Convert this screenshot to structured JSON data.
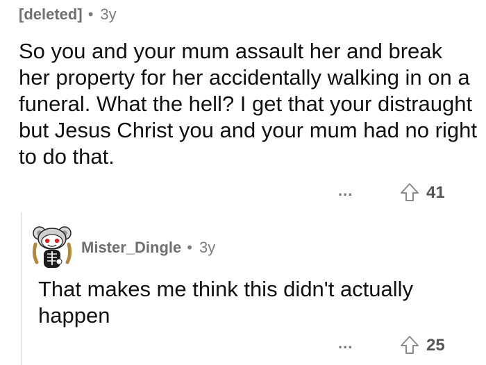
{
  "comment": {
    "author": "[deleted]",
    "age": "3y",
    "body": "So you and your mum assault her and break her property for her accidentally walking in on a funeral. What the hell? I get that your distraught but Jesus Christ you and your mum had no right to do that.",
    "more_label": "...",
    "score": "41"
  },
  "reply": {
    "author": "Mister_Dingle",
    "age": "3y",
    "body": "That makes me think this didn't actually happen",
    "more_label": "...",
    "score": "25",
    "avatar_icon": "snoo-avatar-icon"
  },
  "separator": "•",
  "colors": {
    "meta_text": "#7c7c7c",
    "body_text": "#111111",
    "thread_line": "#e6e6e6",
    "vote_icon": "#8a8a8a"
  },
  "icons": {
    "upvote": "upvote-arrow-icon",
    "more": "more-options-icon"
  }
}
